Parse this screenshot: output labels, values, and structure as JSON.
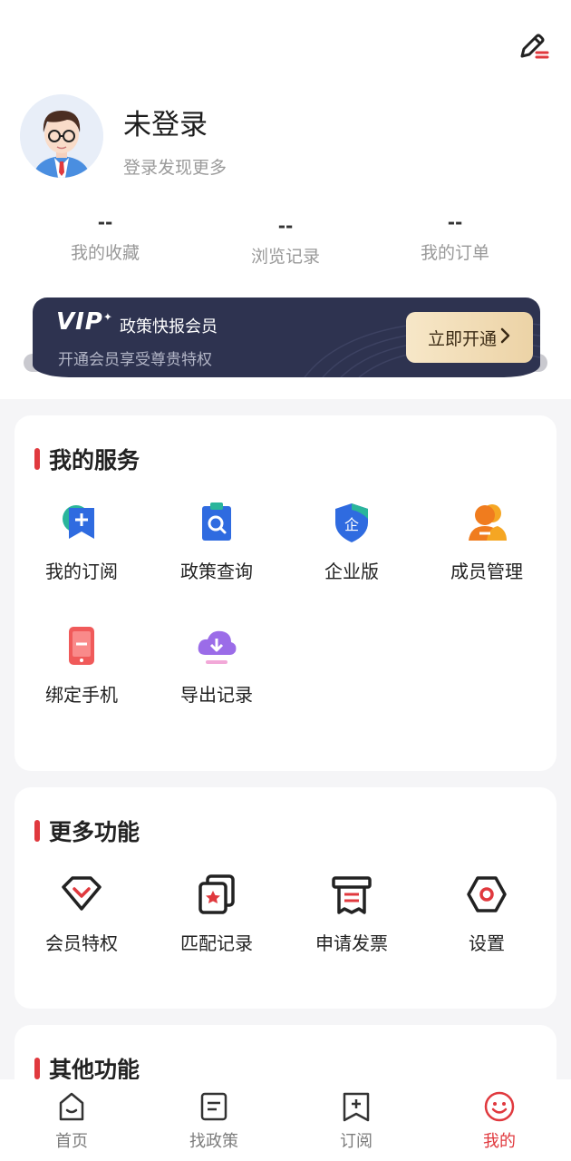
{
  "colors": {
    "accent": "#e0393e",
    "vip_bg": "#2e3350",
    "vip_button": "#f2dcb3"
  },
  "profile": {
    "name": "未登录",
    "subtitle": "登录发现更多",
    "stats": [
      {
        "value": "--",
        "label": "我的收藏"
      },
      {
        "value": "--",
        "label": "浏览记录"
      },
      {
        "value": "--",
        "label": "我的订单"
      }
    ]
  },
  "vip": {
    "logo": "VIP",
    "title": "政策快报会员",
    "subtitle": "开通会员享受尊贵特权",
    "button": "立即开通",
    "button_chevron": "›"
  },
  "services": {
    "title": "我的服务",
    "items": [
      {
        "label": "我的订阅",
        "icon": "subscribe-icon"
      },
      {
        "label": "政策查询",
        "icon": "policy-search-icon"
      },
      {
        "label": "企业版",
        "icon": "enterprise-shield-icon"
      },
      {
        "label": "成员管理",
        "icon": "member-manage-icon"
      },
      {
        "label": "绑定手机",
        "icon": "phone-bind-icon"
      },
      {
        "label": "导出记录",
        "icon": "cloud-download-icon"
      }
    ]
  },
  "more": {
    "title": "更多功能",
    "items": [
      {
        "label": "会员特权",
        "icon": "vip-privilege-icon"
      },
      {
        "label": "匹配记录",
        "icon": "match-record-icon"
      },
      {
        "label": "申请发票",
        "icon": "invoice-icon"
      },
      {
        "label": "设置",
        "icon": "settings-icon"
      }
    ]
  },
  "other": {
    "title": "其他功能"
  },
  "tabbar": {
    "items": [
      {
        "label": "首页",
        "icon": "home-icon",
        "active": false
      },
      {
        "label": "找政策",
        "icon": "find-policy-icon",
        "active": false
      },
      {
        "label": "订阅",
        "icon": "subscribe-tab-icon",
        "active": false
      },
      {
        "label": "我的",
        "icon": "mine-smile-icon",
        "active": true
      }
    ]
  }
}
